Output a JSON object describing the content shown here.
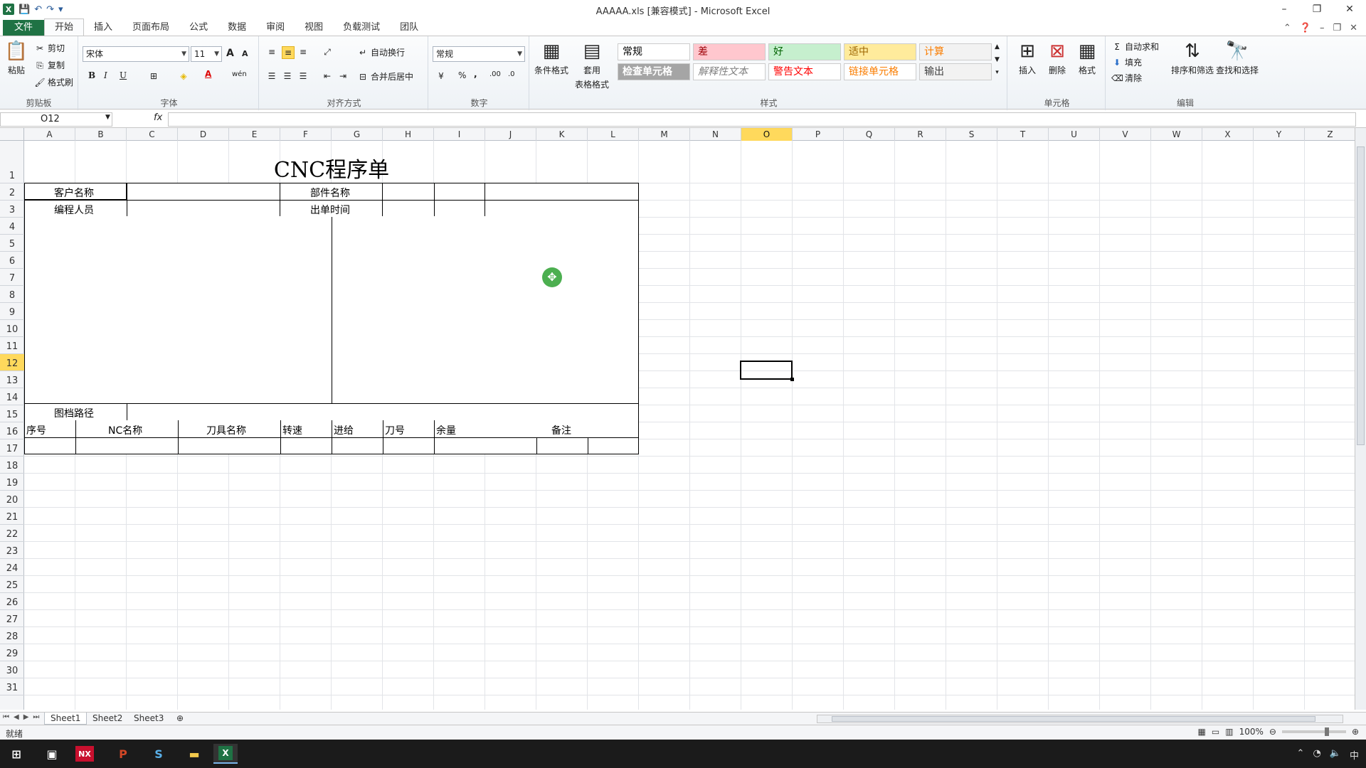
{
  "window": {
    "title": "AAAAA.xls  [兼容模式]  -  Microsoft Excel",
    "controls": {
      "minimize": "–",
      "restore": "❐",
      "close": "✕"
    }
  },
  "quick_access": {
    "save": "💾",
    "undo": "↶",
    "redo": "↷",
    "customize": "▾"
  },
  "tabs": [
    {
      "label": "文件"
    },
    {
      "label": "开始"
    },
    {
      "label": "插入"
    },
    {
      "label": "页面布局"
    },
    {
      "label": "公式"
    },
    {
      "label": "数据"
    },
    {
      "label": "审阅"
    },
    {
      "label": "视图"
    },
    {
      "label": "负载测试"
    },
    {
      "label": "团队"
    }
  ],
  "ribbon": {
    "clipboard": {
      "paste": "粘贴",
      "cut": "剪切",
      "copy": "复制",
      "format_painter": "格式刷",
      "label": "剪贴板"
    },
    "font": {
      "name": "宋体",
      "size": "11",
      "bold": "B",
      "italic": "I",
      "underline": "U",
      "label": "字体",
      "grow": "A",
      "shrink": "A",
      "font_color": "A",
      "phonetic": "wén"
    },
    "alignment": {
      "wrap": "自动换行",
      "merge": "合并后居中",
      "label": "对齐方式"
    },
    "number": {
      "format": "常规",
      "percent": "%",
      "comma": ",",
      "inc_decimal": ".00",
      "dec_decimal": ".0",
      "label": "数字"
    },
    "styles_group": {
      "conditional": "条件格式",
      "table": "套用",
      "table2": "表格格式",
      "label": "样式"
    },
    "styles": [
      {
        "label": "常规",
        "bg": "#ffffff",
        "color": "#000000"
      },
      {
        "label": "差",
        "bg": "#ffc7ce",
        "color": "#9c0006"
      },
      {
        "label": "好",
        "bg": "#c6efce",
        "color": "#006100"
      },
      {
        "label": "适中",
        "bg": "#ffeb9c",
        "color": "#9c6500"
      },
      {
        "label": "计算",
        "bg": "#f2f2f2",
        "color": "#fa7d00"
      },
      {
        "label": "检查单元格",
        "bg": "#a5a5a5",
        "color": "#ffffff"
      },
      {
        "label": "解释性文本",
        "bg": "#ffffff",
        "color": "#7f7f7f"
      },
      {
        "label": "警告文本",
        "bg": "#ffffff",
        "color": "#ff0000"
      },
      {
        "label": "链接单元格",
        "bg": "#ffffff",
        "color": "#fa7d00"
      },
      {
        "label": "输出",
        "bg": "#f2f2f2",
        "color": "#3f3f3f"
      }
    ],
    "cells": {
      "insert": "插入",
      "delete": "删除",
      "format": "格式",
      "label": "单元格"
    },
    "editing": {
      "autosum": "自动求和",
      "fill": "填充",
      "clear": "清除",
      "sort": "排序和筛选",
      "find": "查找和选择",
      "label": "编辑"
    }
  },
  "formula_bar": {
    "name_box": "O12",
    "fx": "fx",
    "value": ""
  },
  "columns": [
    "A",
    "B",
    "C",
    "D",
    "E",
    "F",
    "G",
    "H",
    "I",
    "J",
    "K",
    "L",
    "M",
    "N",
    "O",
    "P",
    "Q",
    "R",
    "S",
    "T",
    "U",
    "V",
    "W",
    "X",
    "Y",
    "Z"
  ],
  "rows": [
    "1",
    "2",
    "3",
    "4",
    "5",
    "6",
    "7",
    "8",
    "9",
    "10",
    "11",
    "12",
    "13",
    "14",
    "15",
    "16",
    "17",
    "18",
    "19",
    "20",
    "21",
    "22",
    "23",
    "24",
    "25",
    "26",
    "27",
    "28",
    "29",
    "30",
    "31"
  ],
  "selected": {
    "column": "O",
    "row": "12"
  },
  "form": {
    "title": "CNC程序单",
    "customer_label": "客户名称",
    "part_label": "部件名称",
    "programmer_label": "编程人员",
    "date_label": "出单时间",
    "drawing_path_label": "图档路径",
    "table_headers": [
      "序号",
      "NC名称",
      "刀具名称",
      "转速",
      "进给",
      "刀号",
      "余量",
      "备注"
    ]
  },
  "sheets": [
    "Sheet1",
    "Sheet2",
    "Sheet3"
  ],
  "status": {
    "ready": "就绪",
    "zoom": "100%"
  },
  "taskbar": {
    "lang": "中"
  }
}
